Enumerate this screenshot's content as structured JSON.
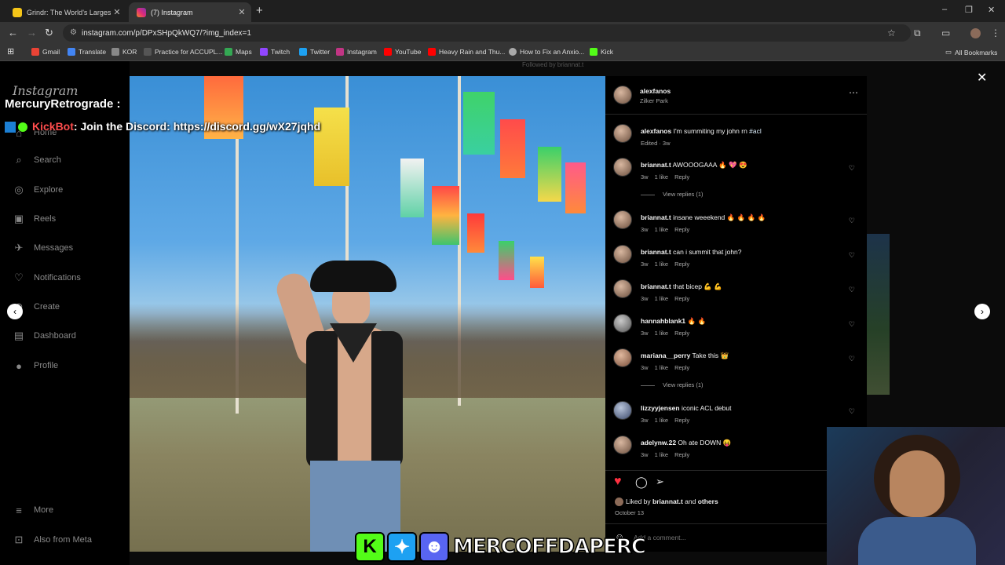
{
  "browser": {
    "tabs": [
      {
        "title": "Grindr: The World's Largest So",
        "favicon_color": "#f5c518"
      },
      {
        "title": "(7) Instagram",
        "favicon_color": "#c13584"
      }
    ],
    "new_tab": "+",
    "window_controls": [
      "–",
      "❐",
      "✕"
    ],
    "url": "instagram.com/p/DPxSHpQkWQ7/?img_index=1",
    "bookmarks": [
      {
        "label": "Gmail",
        "color": "#ea4335"
      },
      {
        "label": "Translate",
        "color": "#4285f4"
      },
      {
        "label": "KOR",
        "color": "#888888"
      },
      {
        "label": "Practice for ACCUPL...",
        "color": "#555555"
      },
      {
        "label": "Maps",
        "color": "#34a853"
      },
      {
        "label": "Twitch",
        "color": "#9146ff"
      },
      {
        "label": "Twitter",
        "color": "#1da1f2"
      },
      {
        "label": "Instagram",
        "color": "#c13584"
      },
      {
        "label": "YouTube",
        "color": "#ff0000"
      },
      {
        "label": "Heavy Rain and Thu...",
        "color": "#ff0000"
      },
      {
        "label": "How to Fix an Anxio...",
        "color": "#aaaaaa"
      },
      {
        "label": "Kick",
        "color": "#53fc18"
      }
    ],
    "all_bookmarks": "All Bookmarks"
  },
  "sidebar": {
    "logo": "Instagram",
    "items": [
      {
        "label": "Home",
        "icon": "home-icon",
        "glyph": "⌂"
      },
      {
        "label": "Search",
        "icon": "search-icon",
        "glyph": "⌕"
      },
      {
        "label": "Explore",
        "icon": "explore-icon",
        "glyph": "◎"
      },
      {
        "label": "Reels",
        "icon": "reels-icon",
        "glyph": "▣"
      },
      {
        "label": "Messages",
        "icon": "messages-icon",
        "glyph": "✈"
      },
      {
        "label": "Notifications",
        "icon": "heart-icon",
        "glyph": "♡"
      },
      {
        "label": "Create",
        "icon": "create-icon",
        "glyph": "⊕"
      },
      {
        "label": "Dashboard",
        "icon": "dashboard-icon",
        "glyph": "▤"
      },
      {
        "label": "Profile",
        "icon": "profile-icon",
        "glyph": "●"
      }
    ],
    "more": "More",
    "also_from_meta": "Also from Meta"
  },
  "overlay": {
    "chat_user": "MercuryRetrograde :",
    "bot_name": "KickBot",
    "bot_message": ": Join the Discord: https://discord.gg/wX27jqhd",
    "followed_by": "Followed by briannat.t",
    "brand": "MERCOFFDAPERC"
  },
  "post": {
    "author": "alexfanos",
    "location": "Zilker Park",
    "caption_user": "alexfanos",
    "caption_text": "I'm summiting my john rn",
    "caption_tag": "#acl",
    "caption_meta": "Edited · 3w",
    "comments": [
      {
        "user": "briannat.t",
        "text": "AWOOOGAAA 🔥 💖 😍",
        "age": "3w",
        "likes": "1 like",
        "reply": "Reply",
        "replies": "View replies (1)"
      },
      {
        "user": "briannat.t",
        "text": "insane weeekend 🔥 🔥 🔥 🔥",
        "age": "3w",
        "likes": "1 like",
        "reply": "Reply"
      },
      {
        "user": "briannat.t",
        "text": "can i summit that john?",
        "age": "3w",
        "likes": "1 like",
        "reply": "Reply"
      },
      {
        "user": "briannat.t",
        "text": "that bicep 💪 💪",
        "age": "3w",
        "likes": "1 like",
        "reply": "Reply"
      },
      {
        "user": "hannahblank1",
        "text": "🔥 🔥",
        "age": "3w",
        "likes": "1 like",
        "reply": "Reply"
      },
      {
        "user": "mariana__perry",
        "text": "Take this 👑",
        "age": "3w",
        "likes": "1 like",
        "reply": "Reply",
        "replies": "View replies (1)"
      },
      {
        "user": "lizzyyjensen",
        "text": "iconic ACL debut",
        "age": "3w",
        "likes": "1 like",
        "reply": "Reply"
      },
      {
        "user": "adelynw.22",
        "text": "Oh ate DOWN 😝",
        "age": "3w",
        "likes": "1 like",
        "reply": "Reply"
      }
    ],
    "liked_by_prefix": "Liked by",
    "liked_by_user": "briannat.t",
    "liked_by_and": "and",
    "liked_by_others": "others",
    "date": "October 13",
    "add_comment_placeholder": "Add a comment..."
  },
  "colors": {
    "accent_like": "#ff3040",
    "link": "#e0f1ff"
  }
}
